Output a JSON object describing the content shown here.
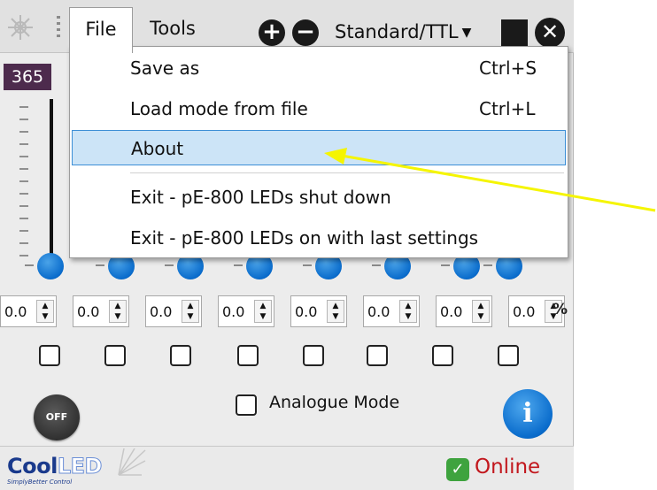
{
  "window": {
    "menu_file": "File",
    "menu_tools": "Tools",
    "add_icon": "plus-circle-icon",
    "remove_icon": "minus-circle-icon",
    "mode_value": "Standard/TTL",
    "close_icon": "close-circle-icon"
  },
  "file_menu": {
    "items": [
      {
        "label": "Save as",
        "shortcut": "Ctrl+S"
      },
      {
        "label": "Load mode from file",
        "shortcut": "Ctrl+L"
      },
      {
        "label": "About",
        "shortcut": ""
      },
      {
        "label": "Exit - pE-800 LEDs shut down",
        "shortcut": ""
      },
      {
        "label": "Exit - pE-800 LEDs on with last settings",
        "shortcut": ""
      }
    ],
    "highlighted": "About"
  },
  "channels": {
    "first_wavelength_label": "365",
    "values": [
      "0.0",
      "0.0",
      "0.0",
      "0.0",
      "0.0",
      "0.0",
      "0.0",
      "0.0"
    ],
    "unit": "%"
  },
  "controls": {
    "off_label": "OFF",
    "analogue_label": "Analogue Mode",
    "info_label": "i"
  },
  "footer": {
    "brand_cool": "Cool",
    "brand_led": "LED",
    "brand_tagline": "SimplyBetter Control",
    "status": "Online"
  },
  "colors": {
    "accent_blue": "#0a6ccc",
    "menu_highlight": "#cce4f7",
    "online_red": "#c2171d",
    "online_green": "#3ea33e",
    "annotation_arrow": "#f5f500"
  }
}
